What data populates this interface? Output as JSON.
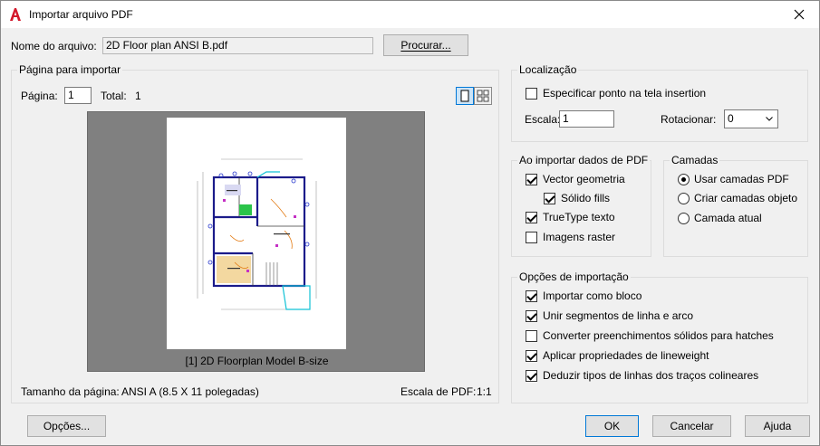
{
  "window": {
    "title": "Importar arquivo PDF",
    "app_icon": "autocad-a-icon",
    "close_icon": "close-icon"
  },
  "file": {
    "label": "Nome do arquivo:",
    "value": "2D Floor plan ANSI B.pdf",
    "browse_label": "Procurar..."
  },
  "page_group": {
    "title": "Página para importar",
    "page_label": "Página:",
    "page_value": "1",
    "total_label": "Total:",
    "total_value": "1",
    "view_single_icon": "single-page-view-icon",
    "view_grid_icon": "grid-view-icon",
    "thumbnail_caption": "[1] 2D Floorplan Model B-size",
    "page_size_label": "Tamanho da página:",
    "page_size_value": "ANSI A (8.5 X 11 polegadas)",
    "pdf_scale_label": "Escala de PDF:",
    "pdf_scale_value": "1:1"
  },
  "location": {
    "title": "Localização",
    "specify_on_screen": {
      "label": "Especificar ponto na tela insertion",
      "checked": false
    },
    "scale_label": "Escala:",
    "scale_value": "1",
    "rotate_label": "Rotacionar:",
    "rotate_value": "0"
  },
  "import_pdf_data": {
    "title": "Ao importar dados de PDF",
    "items": [
      {
        "label": "Vector geometria",
        "checked": true
      },
      {
        "label": "Sólido fills",
        "checked": true
      },
      {
        "label": "TrueType texto",
        "checked": true
      },
      {
        "label": "Imagens raster",
        "checked": false
      }
    ]
  },
  "layers": {
    "title": "Camadas",
    "options": [
      {
        "label": "Usar camadas PDF",
        "selected": true
      },
      {
        "label": "Criar camadas objeto",
        "selected": false
      },
      {
        "label": "Camada atual",
        "selected": false
      }
    ]
  },
  "import_options": {
    "title": "Opções de importação",
    "items": [
      {
        "label": "Importar como bloco",
        "checked": true
      },
      {
        "label": "Unir segmentos de linha e arco",
        "checked": true
      },
      {
        "label": "Converter preenchimentos sólidos para hatches",
        "checked": false
      },
      {
        "label": "Aplicar propriedades de lineweight",
        "checked": true
      },
      {
        "label": "Deduzir tipos de linhas dos traços colineares",
        "checked": true
      }
    ]
  },
  "footer": {
    "options_label": "Opções...",
    "ok_label": "OK",
    "cancel_label": "Cancelar",
    "help_label": "Ajuda"
  }
}
